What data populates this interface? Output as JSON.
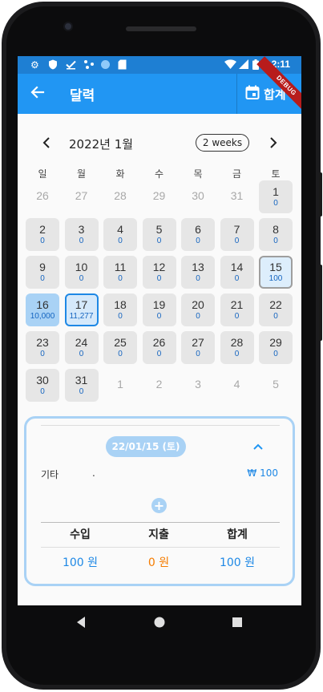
{
  "status_bar": {
    "time": "2:11",
    "left_icons": [
      "settings-icon",
      "shield-icon",
      "checkmark-icon",
      "data-icon",
      "circle-icon",
      "sd-card-icon"
    ],
    "right_icons": [
      "wifi-icon",
      "signal-icon",
      "battery-icon"
    ],
    "debug_banner": "DEBUG"
  },
  "app_bar": {
    "title": "달력",
    "back_icon": "arrow-back-icon",
    "total_button_label": "합계",
    "total_button_icon": "calendar-icon",
    "color": "#2196f3"
  },
  "calendar": {
    "month_label": "2022년 1월",
    "format_button": "2 weeks",
    "weekdays": [
      "일",
      "월",
      "화",
      "수",
      "목",
      "금",
      "토"
    ],
    "weeks": [
      [
        {
          "day": "26",
          "state": "other"
        },
        {
          "day": "27",
          "state": "other"
        },
        {
          "day": "28",
          "state": "other"
        },
        {
          "day": "29",
          "state": "other"
        },
        {
          "day": "30",
          "state": "other"
        },
        {
          "day": "31",
          "state": "other"
        },
        {
          "day": "1",
          "amount": "0",
          "state": "current"
        }
      ],
      [
        {
          "day": "2",
          "amount": "0",
          "state": "current"
        },
        {
          "day": "3",
          "amount": "0",
          "state": "current"
        },
        {
          "day": "4",
          "amount": "0",
          "state": "current"
        },
        {
          "day": "5",
          "amount": "0",
          "state": "current"
        },
        {
          "day": "6",
          "amount": "0",
          "state": "current"
        },
        {
          "day": "7",
          "amount": "0",
          "state": "current"
        },
        {
          "day": "8",
          "amount": "0",
          "state": "current"
        }
      ],
      [
        {
          "day": "9",
          "amount": "0",
          "state": "current"
        },
        {
          "day": "10",
          "amount": "0",
          "state": "current"
        },
        {
          "day": "11",
          "amount": "0",
          "state": "current"
        },
        {
          "day": "12",
          "amount": "0",
          "state": "current"
        },
        {
          "day": "13",
          "amount": "0",
          "state": "current"
        },
        {
          "day": "14",
          "amount": "0",
          "state": "current"
        },
        {
          "day": "15",
          "amount": "100",
          "state": "selected"
        }
      ],
      [
        {
          "day": "16",
          "amount": "10,000",
          "state": "income"
        },
        {
          "day": "17",
          "amount": "11,277",
          "state": "today"
        },
        {
          "day": "18",
          "amount": "0",
          "state": "current"
        },
        {
          "day": "19",
          "amount": "0",
          "state": "current"
        },
        {
          "day": "20",
          "amount": "0",
          "state": "current"
        },
        {
          "day": "21",
          "amount": "0",
          "state": "current"
        },
        {
          "day": "22",
          "amount": "0",
          "state": "current"
        }
      ],
      [
        {
          "day": "23",
          "amount": "0",
          "state": "current"
        },
        {
          "day": "24",
          "amount": "0",
          "state": "current"
        },
        {
          "day": "25",
          "amount": "0",
          "state": "current"
        },
        {
          "day": "26",
          "amount": "0",
          "state": "current"
        },
        {
          "day": "27",
          "amount": "0",
          "state": "current"
        },
        {
          "day": "28",
          "amount": "0",
          "state": "current"
        },
        {
          "day": "29",
          "amount": "0",
          "state": "current"
        }
      ],
      [
        {
          "day": "30",
          "amount": "0",
          "state": "current"
        },
        {
          "day": "31",
          "amount": "0",
          "state": "current"
        },
        {
          "day": "1",
          "state": "other"
        },
        {
          "day": "2",
          "state": "other"
        },
        {
          "day": "3",
          "state": "other"
        },
        {
          "day": "4",
          "state": "other"
        },
        {
          "day": "5",
          "state": "other"
        }
      ]
    ]
  },
  "detail": {
    "date_chip": "22/01/15 (토)",
    "collapse_icon": "chevron-up-icon",
    "entry": {
      "category": "기타",
      "memo": ".",
      "amount": "₩ 100"
    },
    "add_icon": "plus-icon",
    "summary": {
      "headers": [
        "수입",
        "지출",
        "합계"
      ],
      "values": [
        "100 원",
        "0 원",
        "100 원"
      ],
      "colors": [
        "#1e88e5",
        "#f57c00",
        "#1e88e5"
      ]
    }
  },
  "nav_bar": {
    "icons": [
      "back-triangle-icon",
      "home-circle-icon",
      "recents-square-icon"
    ]
  }
}
